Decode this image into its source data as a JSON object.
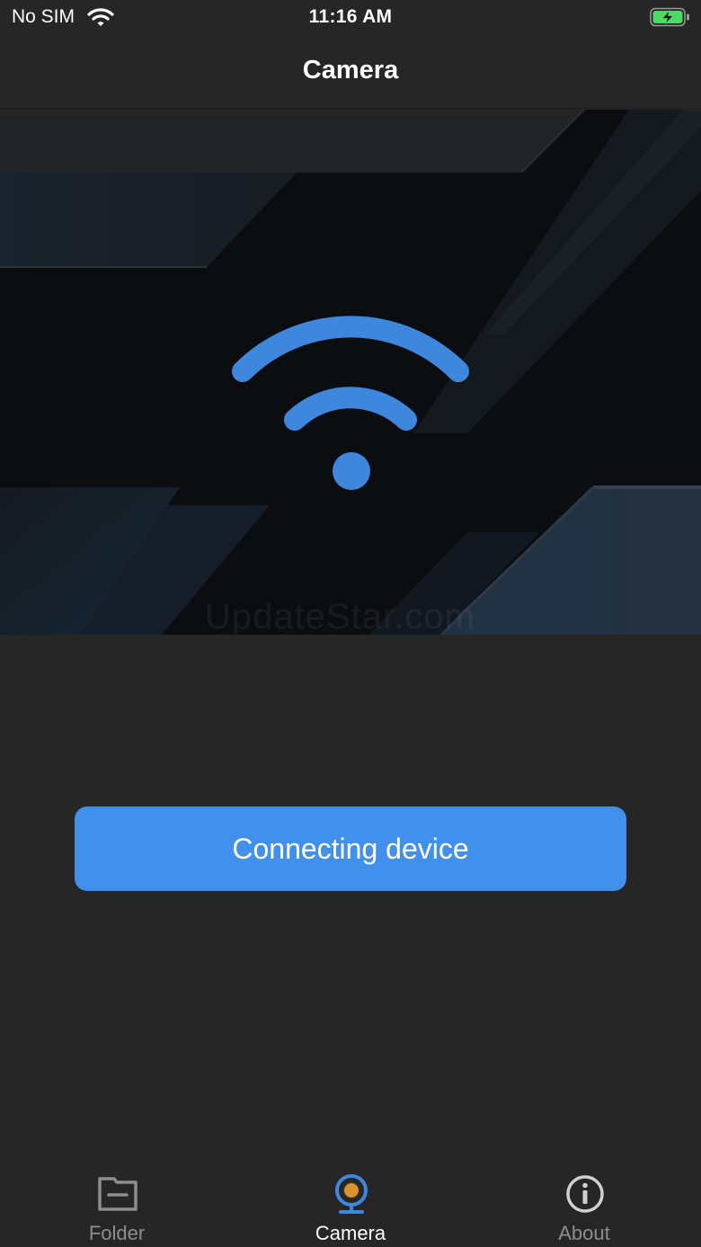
{
  "status_bar": {
    "carrier": "No SIM",
    "time": "11:16 AM",
    "battery_state": "charging",
    "battery_color": "#4cd964"
  },
  "nav": {
    "title": "Camera"
  },
  "hero": {
    "icon": "wifi-icon",
    "icon_color": "#3f86dd",
    "watermark": "UpdateStar.com"
  },
  "connect_button": {
    "label": "Connecting device",
    "color": "#4191ec"
  },
  "tab_bar": {
    "selected": "Camera",
    "tabs": [
      {
        "label": "Folder",
        "icon": "folder-icon"
      },
      {
        "label": "Camera",
        "icon": "camera-icon"
      },
      {
        "label": "About",
        "icon": "info-icon"
      }
    ],
    "active_color": "#ffffff",
    "inactive_color": "#8e8e92",
    "accent_color": "#3f86dd"
  }
}
